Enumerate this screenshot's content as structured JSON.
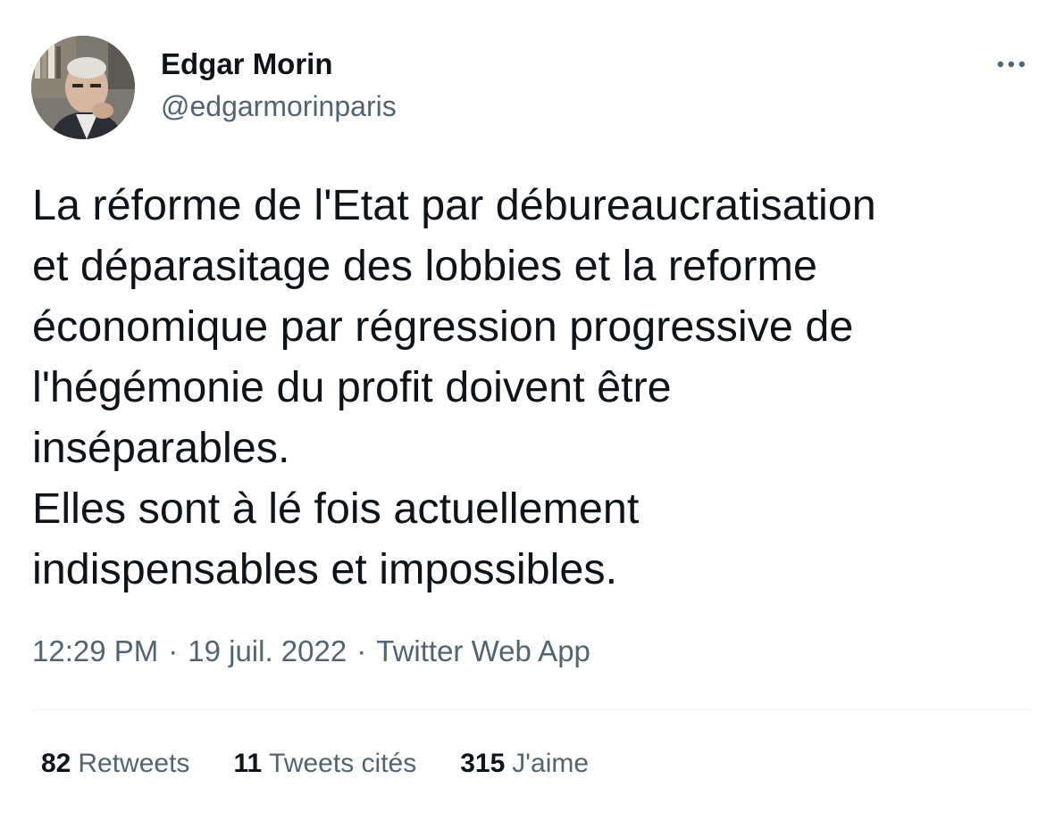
{
  "author": {
    "name": "Edgar Morin",
    "handle": "@edgarmorinparis"
  },
  "more_icon": "more-horizontal-icon",
  "tweet": {
    "lines": [
      "La réforme de l'Etat par débureaucratisation",
      "et déparasitage des lobbies et la reforme",
      "économique par régression progressive de",
      "l'hégémonie du profit doivent être",
      "inséparables.",
      "Elles sont à lé fois actuellement",
      "indispensables et impossibles."
    ]
  },
  "meta": {
    "time": "12:29 PM",
    "separator": "·",
    "date": "19 juil. 2022",
    "source": "Twitter Web App"
  },
  "stats": [
    {
      "count": "82",
      "label": "Retweets"
    },
    {
      "count": "11",
      "label": "Tweets cités"
    },
    {
      "count": "315",
      "label": "J'aime"
    }
  ],
  "colors": {
    "text_primary": "#0f1419",
    "text_secondary": "#536471",
    "divider": "#eff3f4"
  }
}
